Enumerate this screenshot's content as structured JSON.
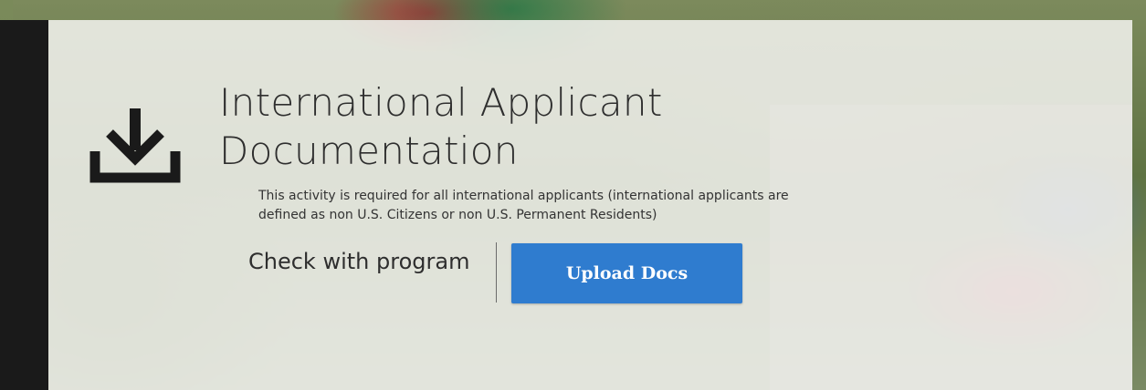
{
  "card": {
    "title": "International Applicant Documentation",
    "description": "This activity is required for all international applicants (international applicants are defined as non U.S. Citizens or non U.S. Permanent Residents)",
    "status_text": "Check with program",
    "upload_button_label": "Upload Docs",
    "icon": "download-icon"
  },
  "colors": {
    "button": "#2f7ccf",
    "icon": "#1a1a1a",
    "text": "#2e2e2e"
  }
}
